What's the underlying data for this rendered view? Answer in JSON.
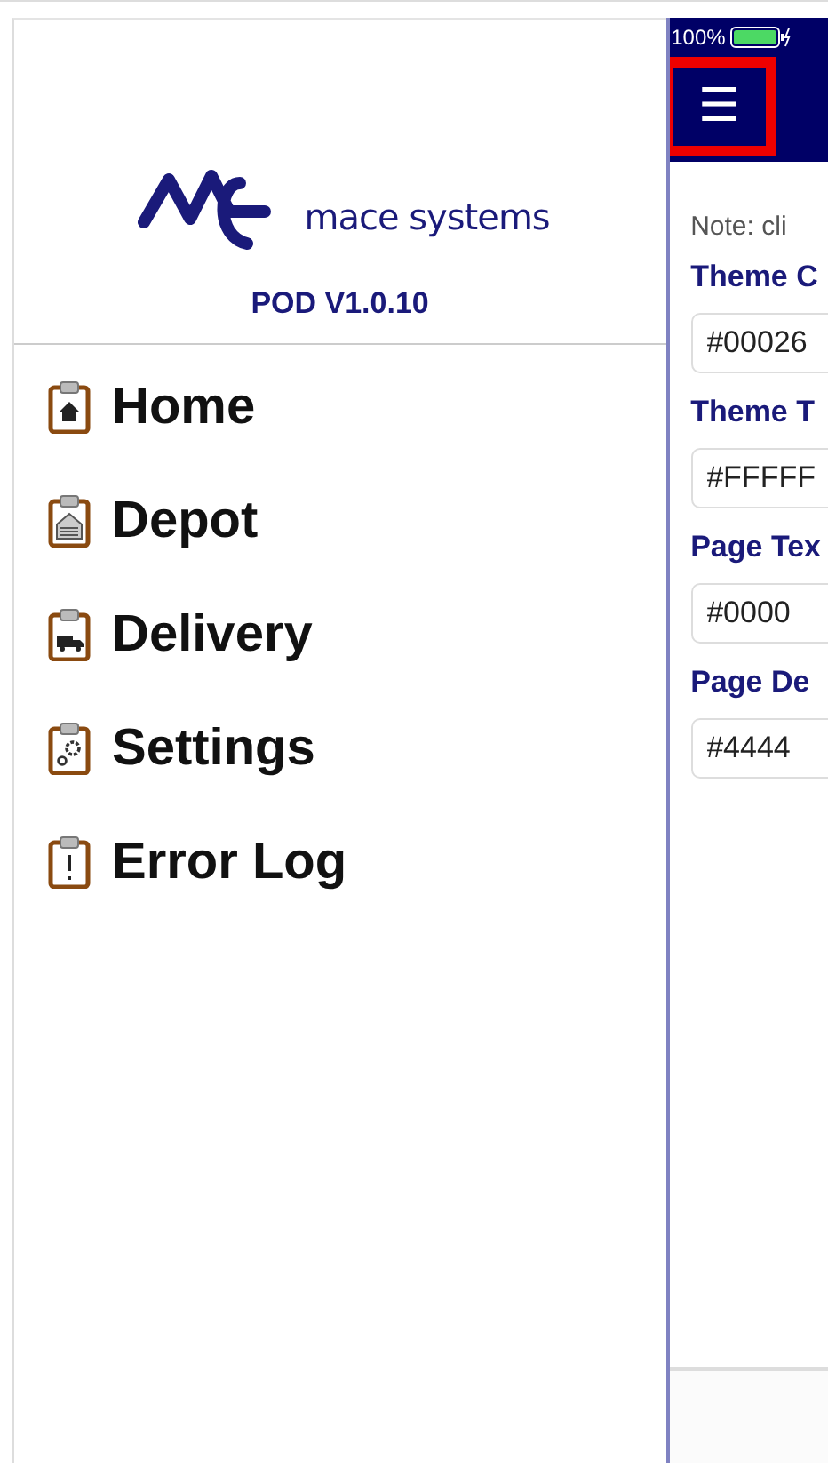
{
  "sidebar": {
    "logo_text": "mace systems",
    "version": "POD V1.0.10",
    "items": [
      {
        "label": "Home",
        "kind": "home"
      },
      {
        "label": "Depot",
        "kind": "depot"
      },
      {
        "label": "Delivery",
        "kind": "delivery"
      },
      {
        "label": "Settings",
        "kind": "settings"
      },
      {
        "label": "Error Log",
        "kind": "log"
      }
    ]
  },
  "status_bar": {
    "battery": "100%"
  },
  "header": {
    "menu_button": {
      "glyph": "☰",
      "highlighted": true
    }
  },
  "content": {
    "note": "Note: cli",
    "fields": [
      {
        "label": "Theme C",
        "value": "#00026"
      },
      {
        "label": "Theme T",
        "value": "#FFFFF"
      },
      {
        "label": "Page Tex",
        "value": "#0000"
      },
      {
        "label": "Page De",
        "value": "#4444"
      }
    ]
  }
}
